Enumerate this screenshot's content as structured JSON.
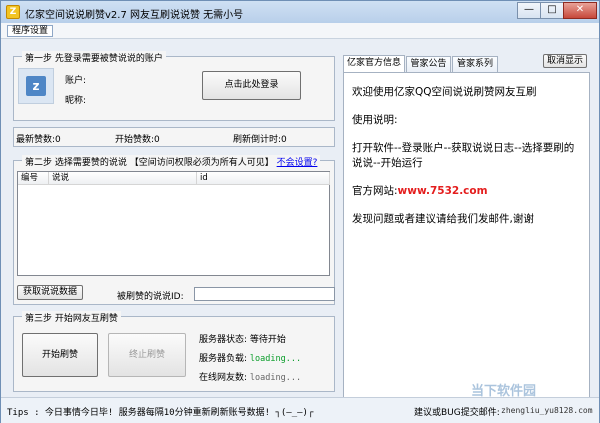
{
  "window": {
    "title": "亿家空间说说刷赞v2.7 网友互刷说说赞 无需小号",
    "menu": "程序设置",
    "controls": [
      "—",
      "□",
      "✕"
    ]
  },
  "step1": {
    "title": "第一步  先登录需要被赞说说的账户",
    "account_label": "账户:",
    "nickname_label": "昵称:",
    "login_button": "点击此处登录"
  },
  "stats": {
    "latest_likes": "最新赞数:0",
    "start_likes": "开始赞数:0",
    "refresh_countdown": "刷新倒计时:0"
  },
  "step2": {
    "title": "第二步  选择需要赞的说说 【空间访问权限必须为所有人可见】",
    "help_link": "不会设置?",
    "columns": [
      "编号",
      "说说",
      "id"
    ],
    "fetch_button": "获取说说数据",
    "target_id_label": "被刷赞的说说ID:",
    "target_id_value": ""
  },
  "step3": {
    "title": "第三步  开始网友互刷赞",
    "start_button": "开始刷赞",
    "stop_button": "终止刷赞",
    "server_status": "服务器状态: 等待开始",
    "server_load_label": "服务器负载:",
    "server_load_value": "loading...",
    "online_label": "在线网友数:",
    "online_value": "loading..."
  },
  "tabs": [
    "亿家官方信息",
    "管家公告",
    "管家系列"
  ],
  "hide_button": "取消显示",
  "info": {
    "welcome": "欢迎使用亿家QQ空间说说刷赞网友互刷",
    "usage_title": "使用说明:",
    "usage": "打开软件--登录账户--获取说说日志--选择要刷的说说--开始运行",
    "website_label": "官方网站:",
    "website": "www.7532.com",
    "feedback": "发现问题或者建议请给我们发邮件,谢谢"
  },
  "status": {
    "tips": "Tips : 今日事情今日毕! 服务器每隔10分钟重新刷新账号数据! ┐(—_—)┌",
    "feedback_label": "建议或BUG提交邮件:",
    "email": "zhengliu_yu8128.com"
  },
  "watermark": "当下软件园",
  "colors": {
    "titlebar": "#b8cfea",
    "link": "#0000ee",
    "website": "#e41d1d",
    "loading": "#0a9d2a"
  }
}
